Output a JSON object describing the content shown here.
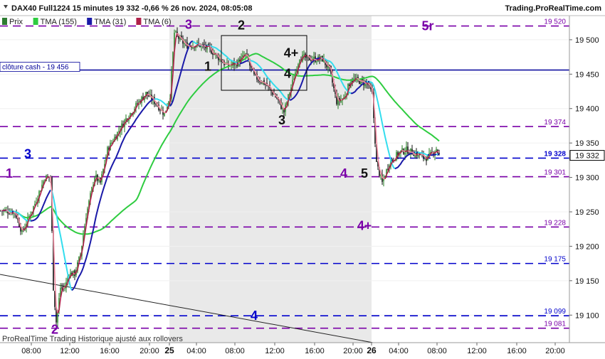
{
  "header": {
    "title": "DAX40 Full1224 15 minutes 19 332 -0,66 % 26 nov. 2024, 08:05:08",
    "site": "Trading.ProRealTime.com"
  },
  "legend": [
    {
      "label": "Prix",
      "color": "#2e7d32"
    },
    {
      "label": "TMA (155)",
      "color": "#2ecc40"
    },
    {
      "label": "TMA (31)",
      "color": "#1a1aa8"
    },
    {
      "label": "TMA (6)",
      "color": "#b0204a"
    }
  ],
  "footer": "ProRealTime Trading  Historique ajusté aux rollovers",
  "colors": {
    "up": "#1f7a1f",
    "down": "#111111",
    "tma155": "#2ecc40",
    "tma31": "#1a1aa8",
    "tma31_alt": "#33ddee",
    "tma6": "#b0204a",
    "tma6_alt": "#f08aa0",
    "purple": "#7a00a8",
    "blue_level": "#0000cc",
    "cloture": "#000099"
  },
  "chart_data": {
    "type": "candlestick",
    "title": "DAX40 Full1224 15 minutes",
    "ylim": [
      19060,
      19535
    ],
    "y_ticks": [
      19100,
      19150,
      19200,
      19250,
      19300,
      19350,
      19400,
      19450,
      19500
    ],
    "y_tick_labels": [
      "19 100",
      "19 150",
      "19 200",
      "19 250",
      "19 300",
      "19 350",
      "19 400",
      "19 450",
      "19 500"
    ],
    "x_ticks": [
      "08:00",
      "12:00",
      "16:00",
      "20:00",
      "25",
      "04:00",
      "08:00",
      "12:00",
      "16:00",
      "20:00",
      "26",
      "04:00",
      "08:00",
      "12:00",
      "16:00",
      "20:00"
    ],
    "last_price": {
      "value": 19332,
      "label": "19 332"
    },
    "hlines": [
      {
        "price": 19520,
        "label": "19 520",
        "color": "purple",
        "style": "dashed"
      },
      {
        "price": 19456,
        "label": "clôture cash -  19 456",
        "color": "cloture",
        "style": "solid"
      },
      {
        "price": 19374,
        "label": "19 374",
        "color": "purple",
        "style": "dashed"
      },
      {
        "price": 19328,
        "label": "19 328",
        "color": "blue_level",
        "style": "dashed"
      },
      {
        "price": 19301,
        "label": "19 301",
        "color": "purple",
        "style": "dashed"
      },
      {
        "price": 19228,
        "label": "19 228",
        "color": "purple",
        "style": "dashed"
      },
      {
        "price": 19175,
        "label": "19 175",
        "color": "blue_level",
        "style": "dashed"
      },
      {
        "price": 19099,
        "label": "19 099",
        "color": "blue_level",
        "style": "dashed"
      },
      {
        "price": 19081,
        "label": "19 081",
        "color": "purple",
        "style": "dashed"
      }
    ],
    "annotations": [
      {
        "text": "1",
        "t": 12,
        "price": 19306,
        "color": "purple"
      },
      {
        "text": "3",
        "t": 38,
        "price": 19334,
        "color": "blue_level"
      },
      {
        "text": "2",
        "t": 76,
        "price": 19079,
        "color": "purple"
      },
      {
        "text": "3",
        "t": 264,
        "price": 19522,
        "color": "purple"
      },
      {
        "text": "1",
        "t": 291,
        "price": 19461,
        "color": "down"
      },
      {
        "text": "2",
        "t": 338,
        "price": 19521,
        "color": "down"
      },
      {
        "text": "4+",
        "t": 408,
        "price": 19481,
        "color": "down"
      },
      {
        "text": "4",
        "t": 403,
        "price": 19451,
        "color": "down"
      },
      {
        "text": "3",
        "t": 395,
        "price": 19383,
        "color": "down"
      },
      {
        "text": "4",
        "t": 482,
        "price": 19306,
        "color": "purple"
      },
      {
        "text": "5",
        "t": 511,
        "price": 19306,
        "color": "down"
      },
      {
        "text": "4+",
        "t": 511,
        "price": 19230,
        "color": "purple"
      },
      {
        "text": "4",
        "t": 356,
        "price": 19099,
        "color": "blue_level"
      },
      {
        "text": "5r",
        "t": 600,
        "price": 19520,
        "color": "purple"
      }
    ]
  }
}
